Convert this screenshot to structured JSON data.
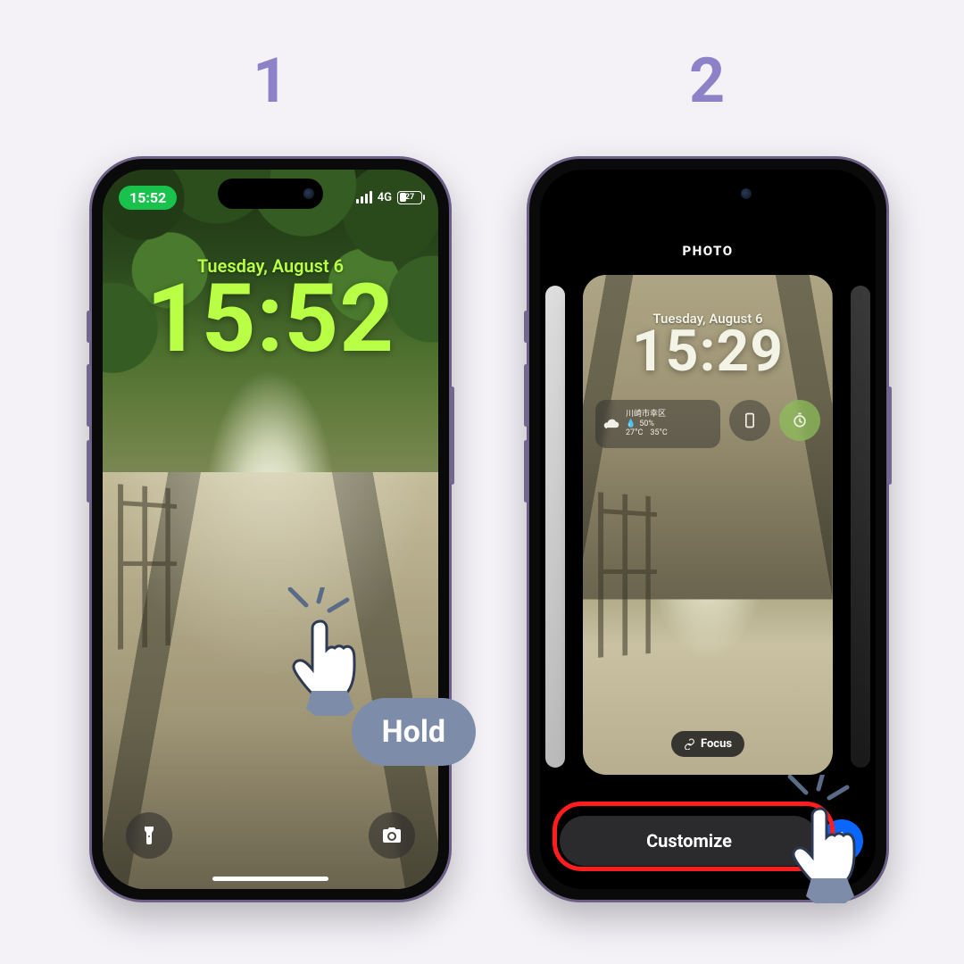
{
  "steps": {
    "one": "1",
    "two": "2"
  },
  "phone1": {
    "status": {
      "time": "15:52",
      "network": "4G",
      "battery": "27"
    },
    "lock": {
      "date": "Tuesday, August 6",
      "time": "15:52"
    },
    "action": {
      "hold": "Hold"
    }
  },
  "phone2": {
    "gallery_title": "PHOTO",
    "card": {
      "date": "Tuesday, August 6",
      "time": "15:29",
      "weather": {
        "location": "川崎市幸区",
        "humidity": "50%",
        "temp_low": "27°C",
        "temp_high": "35°C"
      }
    },
    "focus_label": "Focus",
    "customize_label": "Customize"
  }
}
